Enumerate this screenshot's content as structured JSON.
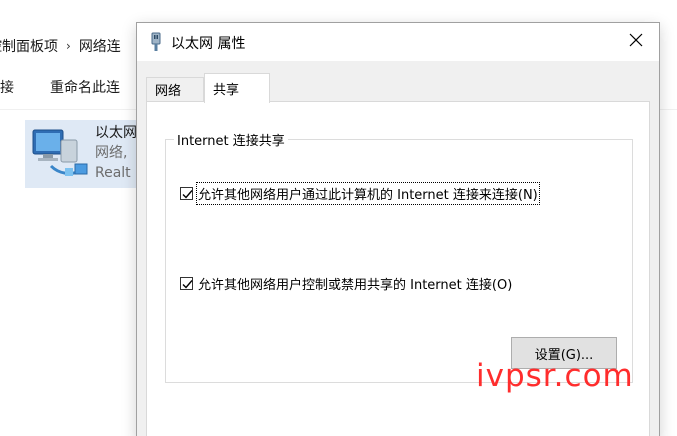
{
  "explorer": {
    "breadcrumb": {
      "item1": "控制面板项",
      "separator": "›",
      "item2": "网络连"
    },
    "toolbar": {
      "connect_label": "连接",
      "rename_label": "重命名此连"
    },
    "adapter": {
      "name": "以太网",
      "status": "网络,",
      "device": "Realt"
    }
  },
  "dialog": {
    "title": "以太网 属性",
    "close_symbol": "✕",
    "tabs": [
      {
        "label": "网络"
      },
      {
        "label": "共享"
      }
    ],
    "active_tab": "共享",
    "sharing": {
      "group_title": "Internet 连接共享",
      "allow_connect": {
        "label": "允许其他网络用户通过此计算机的 Internet 连接来连接(N)",
        "checked": true
      },
      "allow_control": {
        "label": "允许其他网络用户控制或禁用共享的 Internet 连接(O)",
        "checked": true
      },
      "settings_button": "设置(G)..."
    }
  },
  "watermark": "ivpsr.com"
}
